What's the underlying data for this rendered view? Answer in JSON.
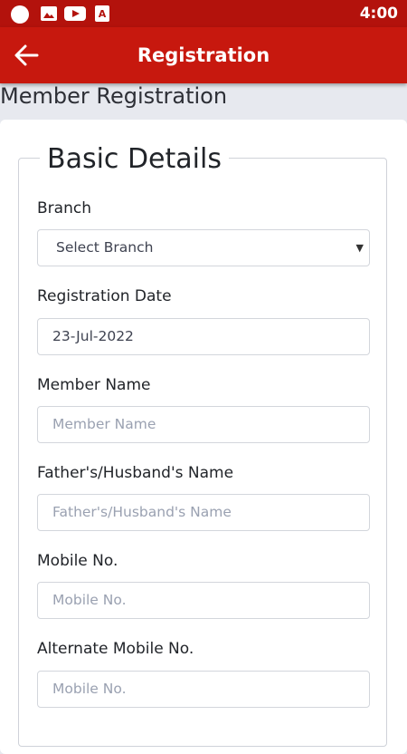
{
  "status_bar": {
    "time": "4:00"
  },
  "app_bar": {
    "title": "Registration"
  },
  "page": {
    "heading": "Member Registration"
  },
  "form": {
    "section_title": "Basic Details",
    "fields": [
      {
        "label": "Branch",
        "value": "Select Branch",
        "type": "select"
      },
      {
        "label": "Registration Date",
        "value": "23-Jul-2022",
        "type": "input"
      },
      {
        "label": "Member Name",
        "placeholder": "Member Name",
        "type": "input"
      },
      {
        "label": "Father's/Husband's Name",
        "placeholder": "Father's/Husband's Name",
        "type": "input"
      },
      {
        "label": "Mobile No.",
        "placeholder": "Mobile No.",
        "type": "input"
      },
      {
        "label": "Alternate Mobile No.",
        "placeholder": "Mobile No.",
        "type": "input"
      }
    ]
  },
  "colors": {
    "status_bar": "#b3120c",
    "app_bar": "#c7180e",
    "background": "#e7e9ef"
  },
  "icons": [
    "circle-notification-icon",
    "image-icon",
    "youtube-icon",
    "app-notification-icon",
    "arrow-back-icon",
    "dropdown-caret-icon"
  ]
}
